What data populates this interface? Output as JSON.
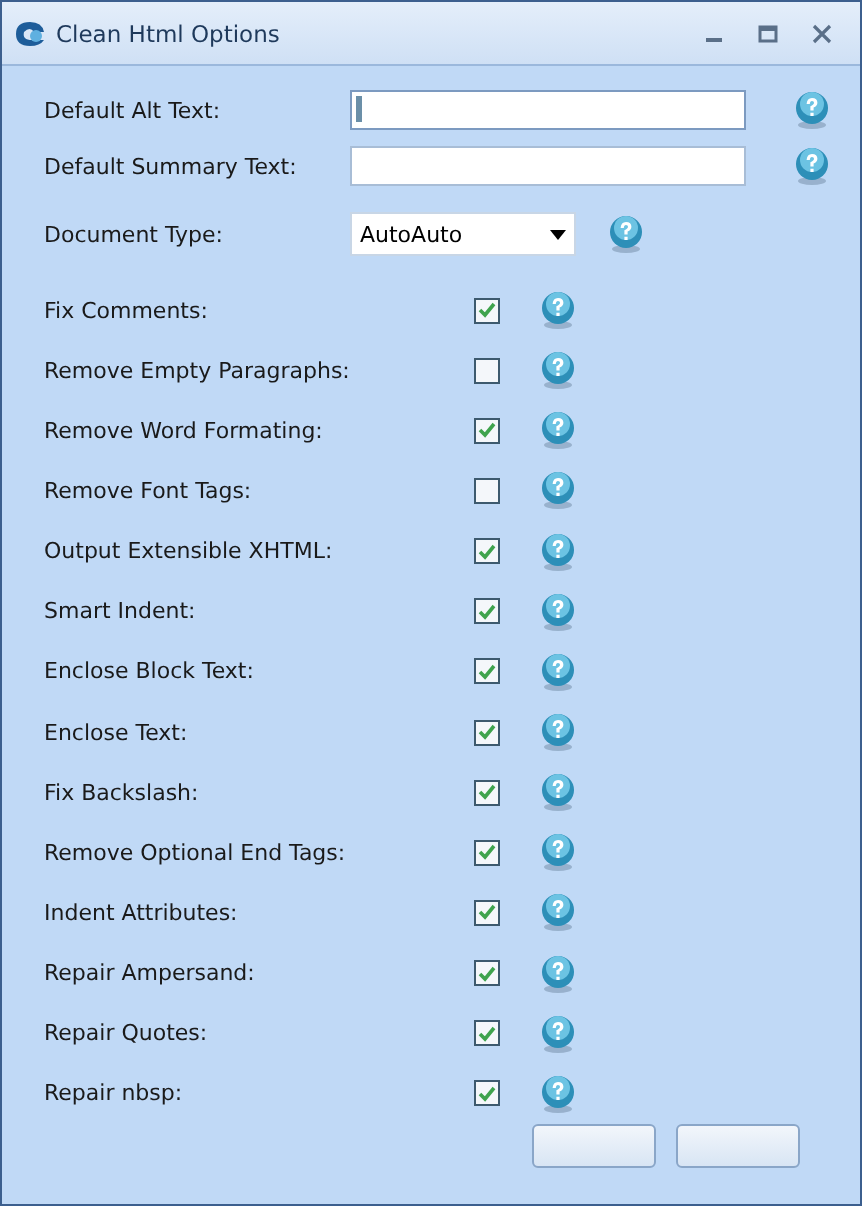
{
  "window": {
    "title": "Clean Html Options"
  },
  "fields": [
    {
      "label": "Default Alt Text:",
      "focused": true
    },
    {
      "label": "Default Summary Text:",
      "focused": false
    }
  ],
  "document_type": {
    "label": "Document Type:",
    "value": "AutoAuto"
  },
  "options": [
    {
      "label": "Fix Comments:",
      "checked": true
    },
    {
      "label": "Remove Empty Paragraphs:",
      "checked": false
    },
    {
      "label": "Remove Word Formating:",
      "checked": true
    },
    {
      "label": "Remove Font Tags:",
      "checked": false
    },
    {
      "label": "Output Extensible XHTML:",
      "checked": true
    },
    {
      "label": "Smart Indent:",
      "checked": true
    },
    {
      "label": "Enclose Block Text:",
      "checked": true
    },
    {
      "label": "Enclose Text:",
      "checked": true
    },
    {
      "label": "Fix Backslash:",
      "checked": true
    },
    {
      "label": "Remove Optional End Tags:",
      "checked": true
    },
    {
      "label": "Indent Attributes:",
      "checked": true
    },
    {
      "label": "Repair Ampersand:",
      "checked": true
    },
    {
      "label": "Repair Quotes:",
      "checked": true
    },
    {
      "label": "Repair nbsp:",
      "checked": true
    }
  ]
}
